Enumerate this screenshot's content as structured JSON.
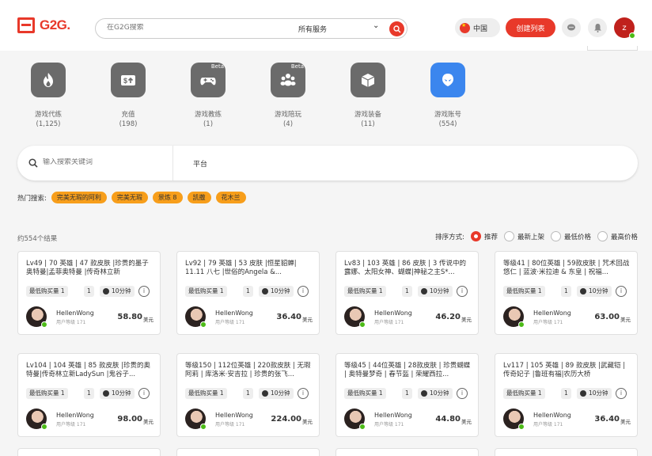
{
  "header": {
    "logo_text": "G2G.",
    "search_placeholder": "在G2G搜索",
    "service_select": "所有服务",
    "region": "中国",
    "create_button": "创建列表",
    "avatar_initial": "z",
    "accent_color": "#e8392a"
  },
  "categories": [
    {
      "name": "游戏代练",
      "count": "(1,125)",
      "icon": "power-leveling-icon",
      "beta": ""
    },
    {
      "name": "充值",
      "count": "(198)",
      "icon": "top-up-icon",
      "beta": ""
    },
    {
      "name": "游戏教练",
      "count": "(1)",
      "icon": "gamepad-icon",
      "beta": "Beta"
    },
    {
      "name": "游戏陪玩",
      "count": "(4)",
      "icon": "companion-icon",
      "beta": "Beta"
    },
    {
      "name": "游戏装备",
      "count": "(11)",
      "icon": "item-box-icon",
      "beta": ""
    },
    {
      "name": "游戏账号",
      "count": "(554)",
      "icon": "account-icon",
      "beta": "",
      "active": true
    }
  ],
  "filter": {
    "keyword_placeholder": "输入搜索关键词",
    "platform_label": "平台"
  },
  "hot_search": {
    "label": "热门搜索:",
    "tags": [
      "完美无瑕的阿利",
      "完美无瑕",
      "景炼 8",
      "凯撒",
      "花木兰"
    ]
  },
  "results": {
    "count_text": "约554个结果",
    "sort_label": "排序方式:",
    "sort_options": [
      "推荐",
      "最新上架",
      "最低价格",
      "最高价格"
    ],
    "selected_sort": 0
  },
  "card_common": {
    "min_label": "最低购买量 1",
    "qty": "1",
    "time": "10分钟",
    "info": "i",
    "seller_name": "HellenWong",
    "seller_level": "用户等级 171",
    "currency": "美元"
  },
  "listings": [
    {
      "title": "Lv49 | 70 英雄 | 47 款皮肤 |珍贵的墨子奥特曼|孟菲奥特曼 |传奇林立新",
      "price": "58.80"
    },
    {
      "title": "Lv92 | 79 英雄 | 53 皮肤 |恒星貂蝉| 11.11 八七 |世俗的Angela &...",
      "price": "36.40"
    },
    {
      "title": "Lv83 | 103 英雄 | 86 皮肤 | 3 传说中的露娜、太阳女神、蝴蝶|神秘之主S*...",
      "price": "46.20"
    },
    {
      "title": "等级41 | 80位英雄 | 59款皮肤 | 咒术回战悠仁 | 蓝波·米拉迪 & 东皇 | 祝福...",
      "price": "63.00"
    },
    {
      "title": "Lv104 | 104 英雄 | 85 款皮肤 |珍贵的奥特曼|传奇林立新LadySun |鬼谷子...",
      "price": "98.00"
    },
    {
      "title": "等级150 | 112位英雄 | 220款皮肤 | 无瑕阿莉 | 库洛米·安吉拉 | 珍贵的张飞...",
      "price": "224.00"
    },
    {
      "title": "等级45 | 44位英雄 | 28款皮肤 | 珍贵蝴蝶 | 奥特曼梦奇 | 春节盔 | 荣耀西拉...",
      "price": "44.80"
    },
    {
      "title": "Lv117 | 105 英雄 | 89 款皮肤 |武藏铠 | 传奇妃子 |鲁班有福|农历大桥",
      "price": "36.40"
    }
  ]
}
